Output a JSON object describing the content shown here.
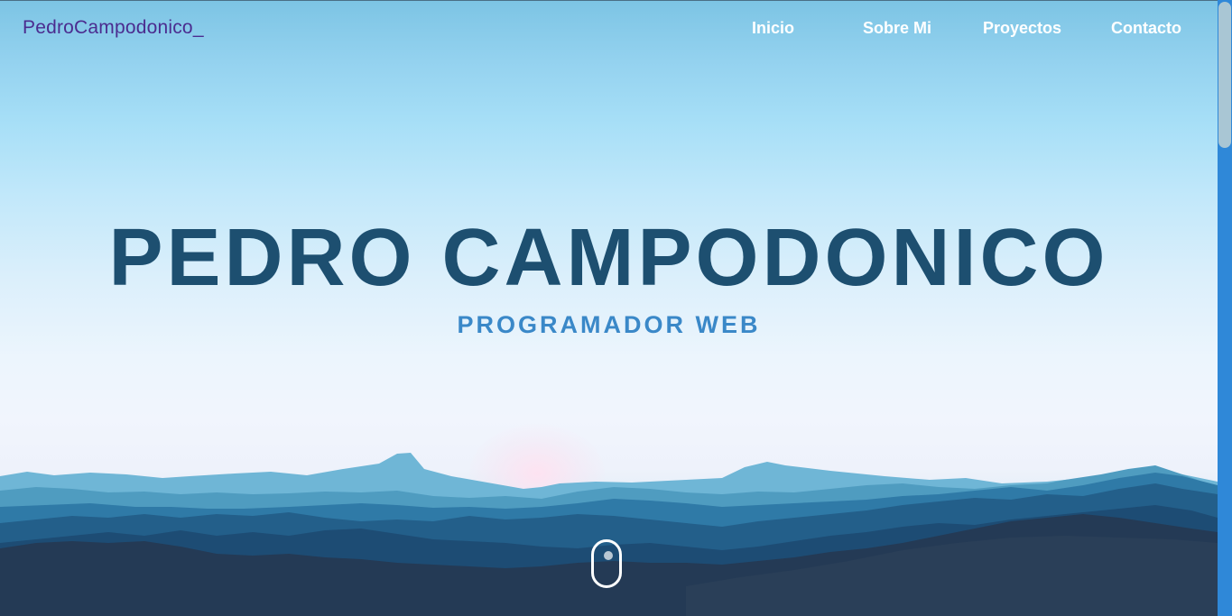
{
  "navbar": {
    "brand": "PedroCampodonico_",
    "links": [
      {
        "label": "Inicio"
      },
      {
        "label": "Sobre Mi"
      },
      {
        "label": "Proyectos"
      },
      {
        "label": "Contacto"
      }
    ]
  },
  "hero": {
    "title": "PEDRO CAMPODONICO",
    "subtitle": "PROGRAMADOR WEB"
  },
  "icons": {
    "scroll": "mouse-scroll-icon"
  },
  "colors": {
    "brand_text": "#4b2c8f",
    "title": "#1d4f70",
    "subtitle": "#3a88c8",
    "nav_text": "#ffffff",
    "scrollbar_track": "#2f88d8"
  }
}
